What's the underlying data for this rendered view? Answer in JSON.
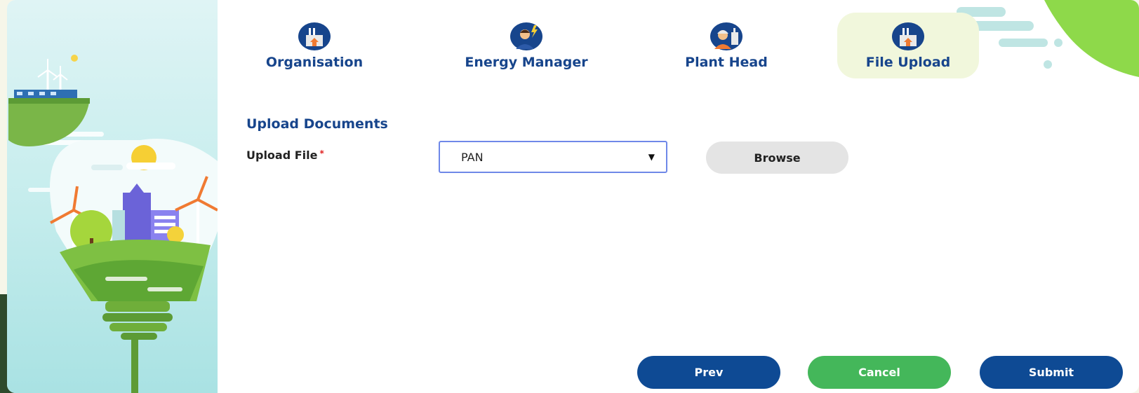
{
  "steps": [
    {
      "label": "Organisation",
      "icon": "factory-icon",
      "active": false
    },
    {
      "label": "Energy Manager",
      "icon": "manager-icon",
      "active": false
    },
    {
      "label": "Plant Head",
      "icon": "plant-head-icon",
      "active": false
    },
    {
      "label": "File Upload",
      "icon": "factory-icon",
      "active": true
    }
  ],
  "form": {
    "section_title": "Upload Documents",
    "upload_label": "Upload File",
    "required_mark": "*",
    "document_type_value": "PAN",
    "browse_label": "Browse"
  },
  "actions": {
    "prev_label": "Prev",
    "cancel_label": "Cancel",
    "submit_label": "Submit"
  },
  "colors": {
    "primary": "#0e4a94",
    "success": "#44b75a",
    "active_step_bg": "#f1f7dc"
  }
}
